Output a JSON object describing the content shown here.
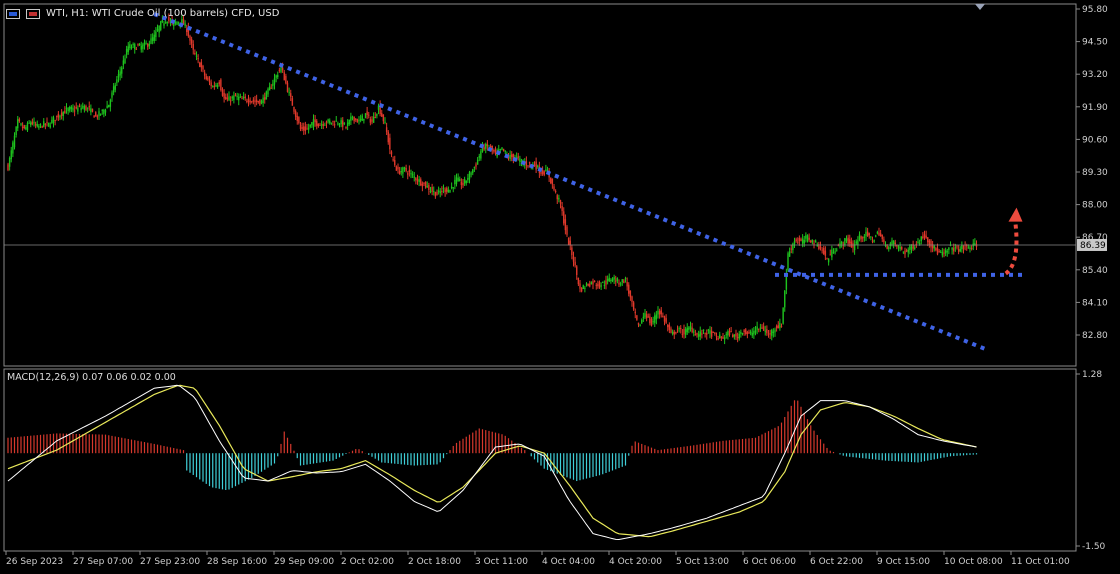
{
  "header": {
    "symbol_text": "WTI, H1:  WTI Crude Oil (100 barrels) CFD, USD"
  },
  "macd": {
    "label": "MACD(12,26,9) 0.07 0.06 0.02 0.00",
    "y_ticks": [
      "1.28",
      "-1.50"
    ]
  },
  "chart_data": {
    "type": "candlestick",
    "symbol": "WTI",
    "timeframe": "H1",
    "price_ticks": [
      "95.80",
      "94.50",
      "93.20",
      "91.90",
      "90.60",
      "89.30",
      "88.00",
      "86.70",
      "85.40",
      "84.10",
      "82.80"
    ],
    "current_price": "86.39",
    "time_labels": [
      "26 Sep 2023",
      "27 Sep 07:00",
      "27 Sep 23:00",
      "28 Sep 16:00",
      "29 Sep 09:00",
      "2 Oct 02:00",
      "2 Oct 18:00",
      "3 Oct 11:00",
      "4 Oct 04:00",
      "4 Oct 20:00",
      "5 Oct 13:00",
      "6 Oct 06:00",
      "6 Oct 22:00",
      "9 Oct 15:00",
      "10 Oct 08:00",
      "11 Oct 01:00"
    ],
    "price_path": [
      [
        0,
        89.5
      ],
      [
        3,
        90.4
      ],
      [
        6,
        91.3
      ],
      [
        10,
        91.0
      ],
      [
        14,
        91.3
      ],
      [
        18,
        91.1
      ],
      [
        22,
        91.2
      ],
      [
        25,
        91.2
      ],
      [
        30,
        91.5
      ],
      [
        34,
        91.7
      ],
      [
        38,
        91.8
      ],
      [
        42,
        91.8
      ],
      [
        46,
        91.9
      ],
      [
        50,
        91.8
      ],
      [
        54,
        91.5
      ],
      [
        58,
        91.7
      ],
      [
        62,
        92.0
      ],
      [
        66,
        92.8
      ],
      [
        70,
        93.5
      ],
      [
        74,
        94.3
      ],
      [
        78,
        94.3
      ],
      [
        82,
        94.3
      ],
      [
        86,
        94.4
      ],
      [
        90,
        94.7
      ],
      [
        94,
        95.2
      ],
      [
        98,
        95.4
      ],
      [
        101,
        95.2
      ],
      [
        104,
        95.3
      ],
      [
        107,
        95.3
      ],
      [
        110,
        95.0
      ],
      [
        114,
        94.1
      ],
      [
        118,
        93.6
      ],
      [
        122,
        93.0
      ],
      [
        126,
        92.7
      ],
      [
        130,
        92.9
      ],
      [
        133,
        92.2
      ],
      [
        136,
        92.2
      ],
      [
        140,
        92.3
      ],
      [
        144,
        92.2
      ],
      [
        148,
        92.2
      ],
      [
        152,
        92.1
      ],
      [
        156,
        92.1
      ],
      [
        160,
        92.5
      ],
      [
        164,
        93.0
      ],
      [
        168,
        93.5
      ],
      [
        172,
        92.6
      ],
      [
        176,
        91.8
      ],
      [
        180,
        91.0
      ],
      [
        184,
        91.0
      ],
      [
        188,
        91.3
      ],
      [
        192,
        91.2
      ],
      [
        196,
        91.3
      ],
      [
        200,
        91.3
      ],
      [
        204,
        91.3
      ],
      [
        208,
        91.1
      ],
      [
        212,
        91.5
      ],
      [
        216,
        91.3
      ],
      [
        220,
        91.6
      ],
      [
        224,
        91.3
      ],
      [
        228,
        91.9
      ],
      [
        232,
        91.2
      ],
      [
        236,
        89.9
      ],
      [
        240,
        89.3
      ],
      [
        244,
        89.4
      ],
      [
        248,
        89.2
      ],
      [
        252,
        89.0
      ],
      [
        256,
        88.8
      ],
      [
        260,
        88.6
      ],
      [
        264,
        88.4
      ],
      [
        268,
        88.6
      ],
      [
        272,
        88.6
      ],
      [
        276,
        89.0
      ],
      [
        280,
        88.8
      ],
      [
        284,
        89.2
      ],
      [
        288,
        89.6
      ],
      [
        292,
        90.3
      ],
      [
        296,
        90.3
      ],
      [
        300,
        90.0
      ],
      [
        304,
        90.2
      ],
      [
        308,
        89.9
      ],
      [
        312,
        89.9
      ],
      [
        316,
        89.7
      ],
      [
        320,
        89.6
      ],
      [
        324,
        89.6
      ],
      [
        328,
        89.3
      ],
      [
        332,
        89.3
      ],
      [
        336,
        88.6
      ],
      [
        340,
        88.0
      ],
      [
        344,
        86.7
      ],
      [
        348,
        85.8
      ],
      [
        352,
        84.6
      ],
      [
        356,
        84.8
      ],
      [
        360,
        84.9
      ],
      [
        364,
        84.8
      ],
      [
        368,
        84.9
      ],
      [
        372,
        85.1
      ],
      [
        376,
        84.9
      ],
      [
        380,
        85.0
      ],
      [
        384,
        84.0
      ],
      [
        388,
        83.1
      ],
      [
        392,
        83.7
      ],
      [
        396,
        83.2
      ],
      [
        400,
        83.8
      ],
      [
        404,
        83.4
      ],
      [
        408,
        82.8
      ],
      [
        412,
        83.0
      ],
      [
        416,
        82.9
      ],
      [
        420,
        83.1
      ],
      [
        424,
        82.8
      ],
      [
        428,
        82.9
      ],
      [
        432,
        82.9
      ],
      [
        436,
        82.7
      ],
      [
        440,
        82.7
      ],
      [
        444,
        82.9
      ],
      [
        448,
        82.7
      ],
      [
        452,
        83.0
      ],
      [
        456,
        82.8
      ],
      [
        460,
        83.0
      ],
      [
        464,
        83.1
      ],
      [
        468,
        82.8
      ],
      [
        472,
        83.1
      ],
      [
        476,
        83.2
      ],
      [
        480,
        86.0
      ],
      [
        484,
        86.6
      ],
      [
        488,
        86.5
      ],
      [
        492,
        86.7
      ],
      [
        496,
        86.5
      ],
      [
        500,
        86.3
      ],
      [
        504,
        85.8
      ],
      [
        508,
        86.2
      ],
      [
        512,
        86.4
      ],
      [
        516,
        86.6
      ],
      [
        520,
        86.3
      ],
      [
        524,
        86.7
      ],
      [
        528,
        86.8
      ],
      [
        532,
        86.6
      ],
      [
        536,
        86.9
      ],
      [
        540,
        86.3
      ],
      [
        544,
        86.5
      ],
      [
        548,
        86.3
      ],
      [
        552,
        86.1
      ],
      [
        556,
        86.3
      ],
      [
        560,
        86.5
      ],
      [
        564,
        86.8
      ],
      [
        568,
        86.4
      ],
      [
        572,
        86.1
      ],
      [
        576,
        86.0
      ],
      [
        580,
        86.3
      ],
      [
        584,
        86.2
      ],
      [
        588,
        86.3
      ],
      [
        592,
        86.3
      ],
      [
        596,
        86.4
      ]
    ],
    "macd_line": [
      [
        0,
        -0.45
      ],
      [
        30,
        0.2
      ],
      [
        60,
        0.6
      ],
      [
        90,
        1.05
      ],
      [
        105,
        1.1
      ],
      [
        115,
        0.9
      ],
      [
        130,
        0.2
      ],
      [
        145,
        -0.4
      ],
      [
        160,
        -0.45
      ],
      [
        175,
        -0.28
      ],
      [
        190,
        -0.32
      ],
      [
        205,
        -0.3
      ],
      [
        220,
        -0.18
      ],
      [
        235,
        -0.45
      ],
      [
        250,
        -0.78
      ],
      [
        265,
        -0.95
      ],
      [
        280,
        -0.6
      ],
      [
        300,
        0.1
      ],
      [
        315,
        0.15
      ],
      [
        330,
        -0.05
      ],
      [
        345,
        -0.75
      ],
      [
        360,
        -1.3
      ],
      [
        375,
        -1.4
      ],
      [
        395,
        -1.3
      ],
      [
        410,
        -1.2
      ],
      [
        430,
        -1.05
      ],
      [
        450,
        -0.85
      ],
      [
        465,
        -0.7
      ],
      [
        478,
        0.0
      ],
      [
        488,
        0.6
      ],
      [
        500,
        0.85
      ],
      [
        515,
        0.85
      ],
      [
        530,
        0.75
      ],
      [
        545,
        0.55
      ],
      [
        560,
        0.3
      ],
      [
        575,
        0.2
      ],
      [
        596,
        0.1
      ]
    ],
    "signal_line": [
      [
        0,
        -0.25
      ],
      [
        30,
        0.05
      ],
      [
        60,
        0.5
      ],
      [
        90,
        0.95
      ],
      [
        105,
        1.1
      ],
      [
        115,
        1.05
      ],
      [
        130,
        0.45
      ],
      [
        145,
        -0.25
      ],
      [
        160,
        -0.45
      ],
      [
        175,
        -0.38
      ],
      [
        190,
        -0.3
      ],
      [
        205,
        -0.25
      ],
      [
        220,
        -0.12
      ],
      [
        235,
        -0.35
      ],
      [
        250,
        -0.6
      ],
      [
        265,
        -0.8
      ],
      [
        280,
        -0.55
      ],
      [
        300,
        0.0
      ],
      [
        315,
        0.12
      ],
      [
        330,
        0.0
      ],
      [
        345,
        -0.5
      ],
      [
        360,
        -1.05
      ],
      [
        375,
        -1.3
      ],
      [
        395,
        -1.35
      ],
      [
        410,
        -1.25
      ],
      [
        430,
        -1.1
      ],
      [
        450,
        -0.95
      ],
      [
        465,
        -0.78
      ],
      [
        478,
        -0.3
      ],
      [
        488,
        0.3
      ],
      [
        500,
        0.7
      ],
      [
        515,
        0.82
      ],
      [
        530,
        0.75
      ],
      [
        545,
        0.6
      ],
      [
        560,
        0.4
      ],
      [
        575,
        0.22
      ],
      [
        596,
        0.1
      ]
    ],
    "histogram": [
      [
        0,
        0.25
      ],
      [
        30,
        0.32
      ],
      [
        60,
        0.3
      ],
      [
        90,
        0.15
      ],
      [
        108,
        0.05
      ],
      [
        110,
        -0.28
      ],
      [
        125,
        -0.55
      ],
      [
        135,
        -0.6
      ],
      [
        150,
        -0.4
      ],
      [
        165,
        -0.15
      ],
      [
        170,
        0.35
      ],
      [
        175,
        0.1
      ],
      [
        180,
        -0.2
      ],
      [
        200,
        -0.12
      ],
      [
        215,
        0.08
      ],
      [
        230,
        -0.15
      ],
      [
        250,
        -0.2
      ],
      [
        265,
        -0.18
      ],
      [
        275,
        0.15
      ],
      [
        290,
        0.4
      ],
      [
        305,
        0.3
      ],
      [
        318,
        0.05
      ],
      [
        330,
        -0.25
      ],
      [
        350,
        -0.45
      ],
      [
        365,
        -0.35
      ],
      [
        380,
        -0.2
      ],
      [
        385,
        0.2
      ],
      [
        400,
        0.05
      ],
      [
        420,
        0.12
      ],
      [
        440,
        0.2
      ],
      [
        460,
        0.25
      ],
      [
        475,
        0.45
      ],
      [
        485,
        0.9
      ],
      [
        495,
        0.4
      ],
      [
        505,
        0.05
      ],
      [
        515,
        -0.05
      ],
      [
        540,
        -0.12
      ],
      [
        560,
        -0.15
      ],
      [
        580,
        -0.05
      ],
      [
        596,
        -0.02
      ]
    ],
    "trendlines": [
      {
        "points": [
          [
            90,
            95.6
          ],
          [
            603,
            82.2
          ]
        ],
        "style": "dotted",
        "color": "#3f63e6"
      },
      {
        "points": [
          [
            472,
            85.2
          ],
          [
            627,
            85.2
          ]
        ],
        "style": "dotted",
        "color": "#3f63e6"
      }
    ],
    "annotation_arrow": {
      "color": "#ee4b3e"
    }
  },
  "colors": {
    "background": "#000000",
    "bull_candle": "#1ec31e",
    "bear_candle": "#e0392b",
    "macd_pos": "#d7382d",
    "macd_neg": "#3fd0d8",
    "signal": "#e8e85a",
    "macd_line": "#ffffff",
    "trendline": "#3f63e6",
    "arrow": "#ee4b3e",
    "grid_axis": "#8a8a8a"
  }
}
